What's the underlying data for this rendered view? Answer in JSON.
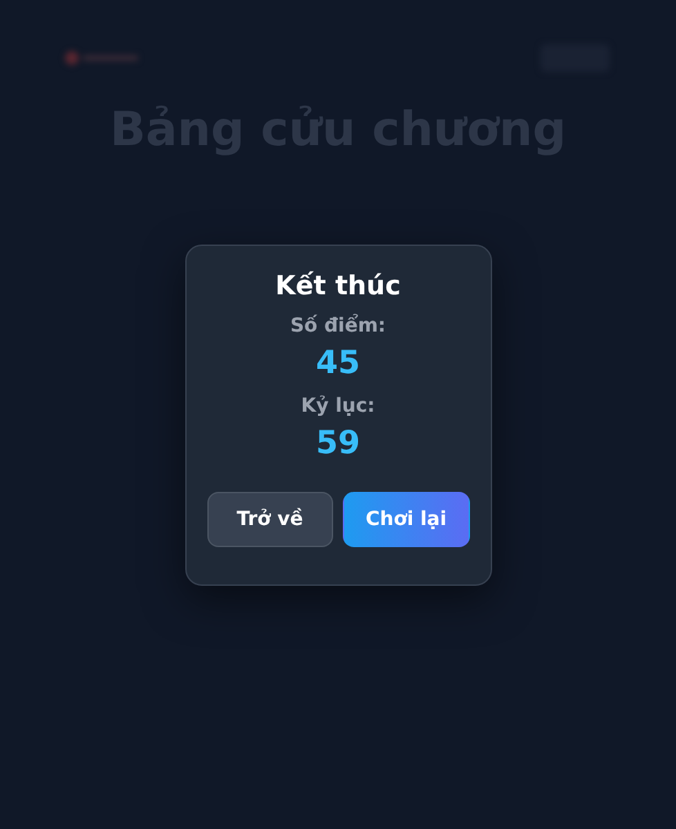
{
  "background": {
    "title": "Bảng cửu chương"
  },
  "dialog": {
    "title": "Kết thúc",
    "score_label": "Số điểm:",
    "score": "45",
    "best_label": "Kỷ lục:",
    "best": "59",
    "buttons": [
      {
        "label": "Trở về",
        "kind": "secondary"
      },
      {
        "label": "Chơi lại",
        "kind": "primary"
      }
    ]
  }
}
